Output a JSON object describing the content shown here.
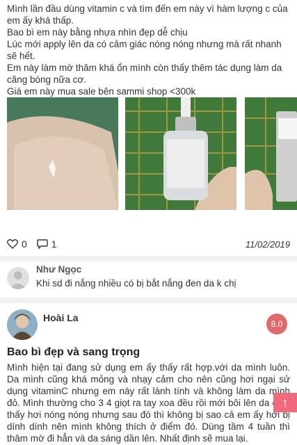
{
  "review_text": [
    "Mình lần đầu dùng vitamin c và tìm đến em này vì hàm lượng c của em ấy khá thấp.",
    "Bao bì em này bằng nhựa nhìn đẹp dễ chịu",
    "Lúc mới apply lên da có cảm giác nóng nóng nhưng mà rất nhanh sẽ hết.",
    "Em này làm mờ thâm khá ổn mình còn thấy thêm tác dụng làm da căng bóng nữa cơ.",
    "Giá em này mua sale bên sammi shop <300k"
  ],
  "actions": {
    "likes": "0",
    "comments": "1",
    "date": "11/02/2019"
  },
  "comment": {
    "name": "Như Ngọc",
    "text": "Khi sd đi nắng nhiều có bị bắt nắng đen da k chị"
  },
  "review2": {
    "author": "Hoài La",
    "score": "8.0",
    "title": "Bao bì đẹp và sang trọng",
    "body": "Mình hiện tại đang sử dụng em ấy thấy rất hợp.với da mình luôn. Da mình cũng khá mỏng và nhạy cảm cho nên cũng hơi ngại sử dụng vitaminC nhưng em này rất lành tính và không làm da mình đỏ. Mình thường cho 3 4 giọt ra tay xoa đều rồi mới bôi lên da cảm thấy hơi nóng nóng nhưng sau đó thì không bị sao cả em ấy hơi bị dính dính nên mình không thích ở điểm đó. Dùng tầm 4 tuần thì thâm mờ đi hẳn và da sáng dần lên. Nhất định sẽ mua lại."
  },
  "scroll_top_icon": "arrow-up-icon"
}
